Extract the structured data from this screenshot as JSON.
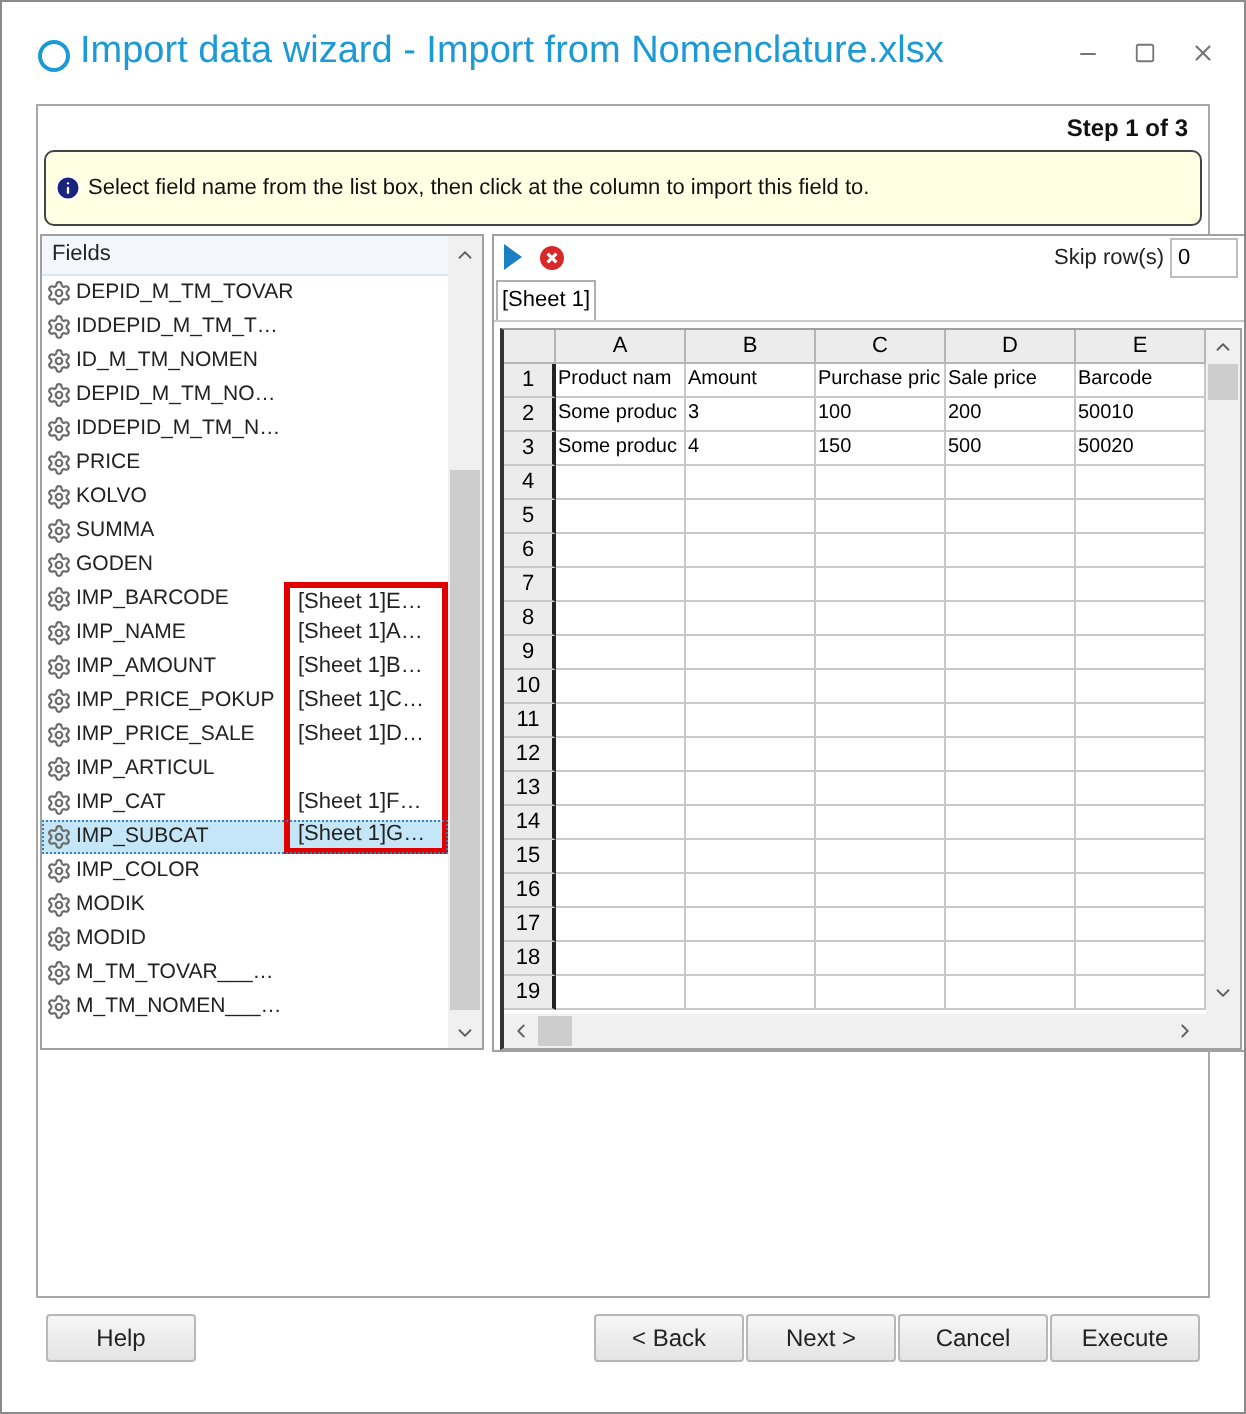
{
  "window": {
    "title": "Import data wizard - Import from Nomenclature.xlsx"
  },
  "step": "Step 1 of 3",
  "hint": "Select field name from the list box, then click at the column to import this field to.",
  "fields": {
    "header": "Fields",
    "items": [
      {
        "name": "DEPID_M_TM_TOVAR",
        "selected": false,
        "highlighted": false
      },
      {
        "name": "IDDEPID_M_TM_T…",
        "selected": false,
        "highlighted": false
      },
      {
        "name": "ID_M_TM_NOMEN",
        "selected": false,
        "highlighted": false
      },
      {
        "name": "DEPID_M_TM_NO…",
        "selected": false,
        "highlighted": false
      },
      {
        "name": "IDDEPID_M_TM_N…",
        "selected": false,
        "highlighted": false
      },
      {
        "name": "PRICE",
        "selected": false,
        "highlighted": false
      },
      {
        "name": "KOLVO",
        "selected": false,
        "highlighted": false
      },
      {
        "name": "SUMMA",
        "selected": false,
        "highlighted": false
      },
      {
        "name": "GODEN",
        "selected": false,
        "highlighted": false
      },
      {
        "name": "IMP_BARCODE",
        "mapping": "[Sheet 1]E…",
        "selected": false,
        "highlighted": true
      },
      {
        "name": "IMP_NAME",
        "mapping": "[Sheet 1]A…",
        "selected": false,
        "highlighted": true
      },
      {
        "name": "IMP_AMOUNT",
        "mapping": "[Sheet 1]B…",
        "selected": false,
        "highlighted": true
      },
      {
        "name": "IMP_PRICE_POKUP",
        "mapping": "[Sheet 1]C…",
        "selected": false,
        "highlighted": true
      },
      {
        "name": "IMP_PRICE_SALE",
        "mapping": "[Sheet 1]D…",
        "selected": false,
        "highlighted": true
      },
      {
        "name": "IMP_ARTICUL",
        "selected": false,
        "highlighted": true
      },
      {
        "name": "IMP_CAT",
        "mapping": "[Sheet 1]F…",
        "selected": false,
        "highlighted": true
      },
      {
        "name": "IMP_SUBCAT",
        "mapping": "[Sheet 1]G…",
        "selected": true,
        "highlighted": true
      },
      {
        "name": "IMP_COLOR",
        "selected": false,
        "highlighted": false
      },
      {
        "name": "MODIK",
        "selected": false,
        "highlighted": false
      },
      {
        "name": "MODID",
        "selected": false,
        "highlighted": false
      },
      {
        "name": "M_TM_TOVAR___…",
        "selected": false,
        "highlighted": false
      },
      {
        "name": "M_TM_NOMEN___…",
        "selected": false,
        "highlighted": false
      }
    ]
  },
  "toolbar": {
    "skip_label": "Skip row(s)",
    "skip_value": "0"
  },
  "sheet_tabs": [
    {
      "label": "[Sheet 1]",
      "selected": true
    }
  ],
  "grid": {
    "columns": [
      "A",
      "B",
      "C",
      "D",
      "E"
    ],
    "rows": [
      {
        "number": "1",
        "cells": [
          "Product nam",
          "Amount",
          "Purchase pric",
          "Sale price",
          "Barcode"
        ]
      },
      {
        "number": "2",
        "cells": [
          "Some produc",
          "3",
          "100",
          "200",
          "50010"
        ]
      },
      {
        "number": "3",
        "cells": [
          "Some produc",
          "4",
          "150",
          "500",
          "50020"
        ]
      },
      {
        "number": "4"
      },
      {
        "number": "5"
      },
      {
        "number": "6"
      },
      {
        "number": "7"
      },
      {
        "number": "8"
      },
      {
        "number": "9"
      },
      {
        "number": "10"
      },
      {
        "number": "11"
      },
      {
        "number": "12"
      },
      {
        "number": "13"
      },
      {
        "number": "14"
      },
      {
        "number": "15"
      },
      {
        "number": "16"
      },
      {
        "number": "17"
      },
      {
        "number": "18"
      },
      {
        "number": "19"
      }
    ]
  },
  "buttons": {
    "left": [
      {
        "label": "Help"
      }
    ],
    "right": [
      {
        "label": "< Back"
      },
      {
        "label": "Next >"
      },
      {
        "label": "Cancel"
      },
      {
        "label": "Execute"
      }
    ]
  }
}
